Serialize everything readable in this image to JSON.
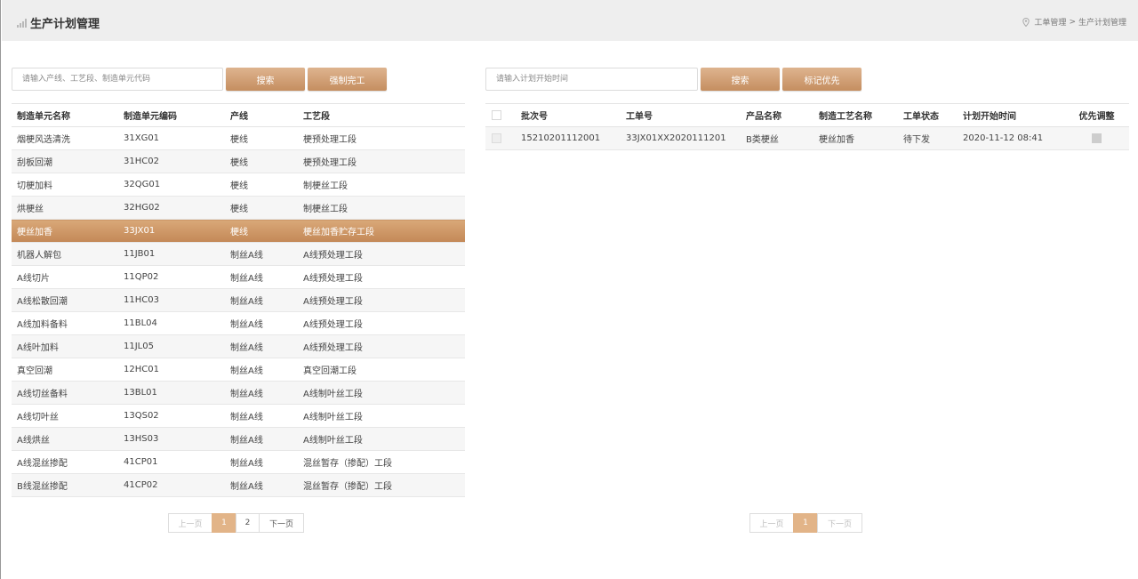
{
  "header": {
    "title": "生产计划管理",
    "breadcrumb": [
      "工单管理",
      "生产计划管理"
    ],
    "breadcrumb_sep": ">"
  },
  "left": {
    "search_placeholder": "请输入产线、工艺段、制造单元代码",
    "search_label": "搜索",
    "action_label": "强制完工",
    "columns": [
      "制造单元名称",
      "制造单元编码",
      "产线",
      "工艺段"
    ],
    "rows": [
      [
        "烟梗风选清洗",
        "31XG01",
        "梗线",
        "梗预处理工段"
      ],
      [
        "刮板回潮",
        "31HC02",
        "梗线",
        "梗预处理工段"
      ],
      [
        "切梗加料",
        "32QG01",
        "梗线",
        "制梗丝工段"
      ],
      [
        "烘梗丝",
        "32HG02",
        "梗线",
        "制梗丝工段"
      ],
      [
        "梗丝加香",
        "33JX01",
        "梗线",
        "梗丝加香贮存工段"
      ],
      [
        "机器人解包",
        "11JB01",
        "制丝A线",
        "A线预处理工段"
      ],
      [
        "A线切片",
        "11QP02",
        "制丝A线",
        "A线预处理工段"
      ],
      [
        "A线松散回潮",
        "11HC03",
        "制丝A线",
        "A线预处理工段"
      ],
      [
        "A线加料备料",
        "11BL04",
        "制丝A线",
        "A线预处理工段"
      ],
      [
        "A线叶加料",
        "11JL05",
        "制丝A线",
        "A线预处理工段"
      ],
      [
        "真空回潮",
        "12HC01",
        "制丝A线",
        "真空回潮工段"
      ],
      [
        "A线切丝备料",
        "13BL01",
        "制丝A线",
        "A线制叶丝工段"
      ],
      [
        "A线切叶丝",
        "13QS02",
        "制丝A线",
        "A线制叶丝工段"
      ],
      [
        "A线烘丝",
        "13HS03",
        "制丝A线",
        "A线制叶丝工段"
      ],
      [
        "A线混丝掺配",
        "41CP01",
        "制丝A线",
        "混丝暂存（掺配）工段"
      ],
      [
        "B线混丝掺配",
        "41CP02",
        "制丝A线",
        "混丝暂存（掺配）工段"
      ]
    ],
    "selected_row": 4,
    "pager": {
      "prev": "上一页",
      "pages": [
        "1",
        "2"
      ],
      "active": "1",
      "next": "下一页"
    }
  },
  "right": {
    "search_placeholder": "请输入计划开始时间",
    "search_label": "搜索",
    "action_label": "标记优先",
    "columns": [
      "批次号",
      "工单号",
      "产品名称",
      "制造工艺名称",
      "工单状态",
      "计划开始时间",
      "优先调整"
    ],
    "rows": [
      [
        "15210201112001",
        "33JX01XX2020111201",
        "B类梗丝",
        "梗丝加香",
        "待下发",
        "2020-11-12 08:41"
      ]
    ],
    "pager": {
      "prev": "上一页",
      "pages": [
        "1"
      ],
      "active": "1",
      "next": "下一页"
    }
  },
  "colors": {
    "accent": "#d09d70",
    "accent_light": "#e2b488",
    "header_bg": "#eeeeee"
  }
}
